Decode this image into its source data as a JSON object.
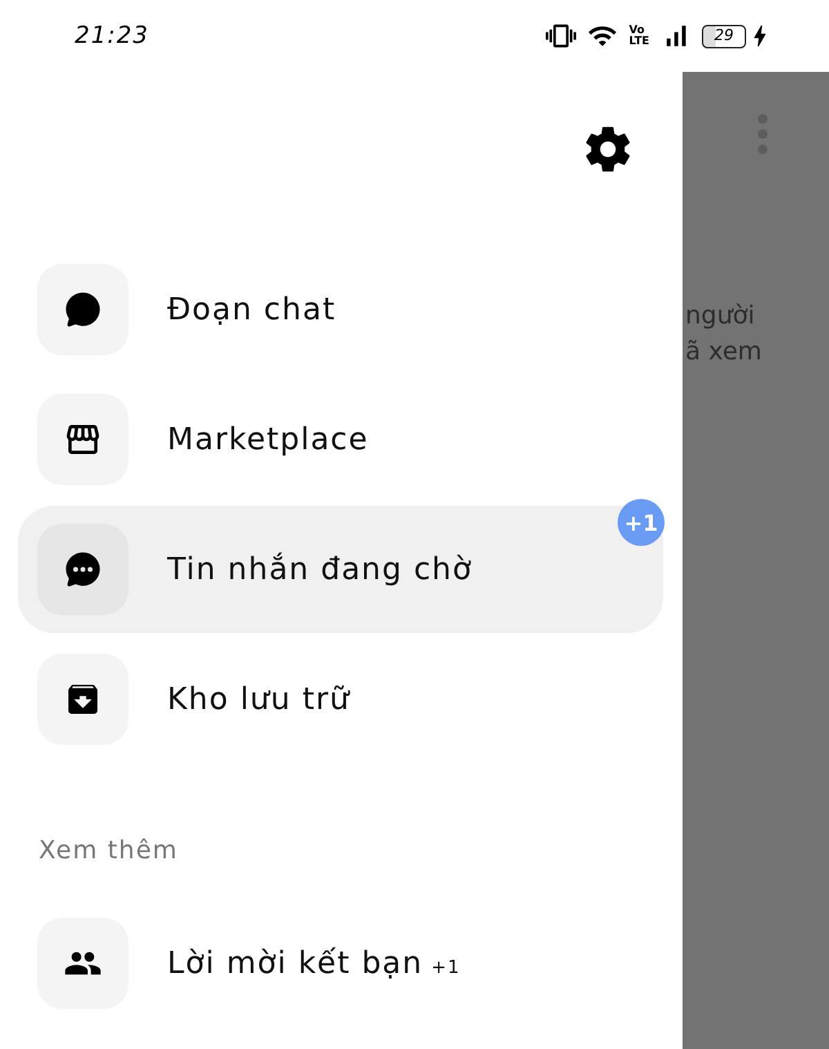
{
  "status_bar": {
    "time": "21:23",
    "network_top": "Vo",
    "network_bottom": "LTE",
    "battery": "29",
    "charging": true
  },
  "menu": {
    "items": [
      {
        "label": "Đoạn chat",
        "kind": "chat",
        "selected": false
      },
      {
        "label": "Marketplace",
        "kind": "store",
        "selected": false
      },
      {
        "label": "Tin nhắn đang chờ",
        "kind": "pending",
        "selected": true,
        "badge": "+1"
      },
      {
        "label": "Kho lưu trữ",
        "kind": "archive",
        "selected": false
      }
    ]
  },
  "section": {
    "title": "Xem thêm",
    "items": [
      {
        "label": "Lời mời kết bạn",
        "kind": "friends",
        "count": "+1",
        "selected": false
      }
    ]
  },
  "background_text": [
    "người",
    "ã xem"
  ]
}
